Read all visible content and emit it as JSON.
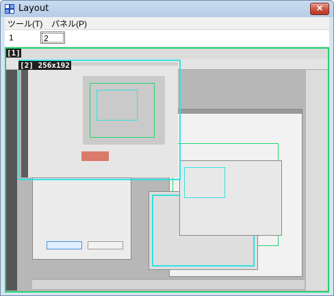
{
  "window": {
    "title": "Layout",
    "close_glyph": "✕"
  },
  "menubar": {
    "items": [
      "ツール(T)",
      "パネル(P)"
    ]
  },
  "tabs": {
    "items": [
      "1",
      "2"
    ],
    "selected": "2"
  },
  "overlays": {
    "frame1_label": "[1]",
    "frame2_label": "[2] 256x192"
  },
  "colors": {
    "frame1": "#1fd46a",
    "frame2": "#33e0e0"
  }
}
